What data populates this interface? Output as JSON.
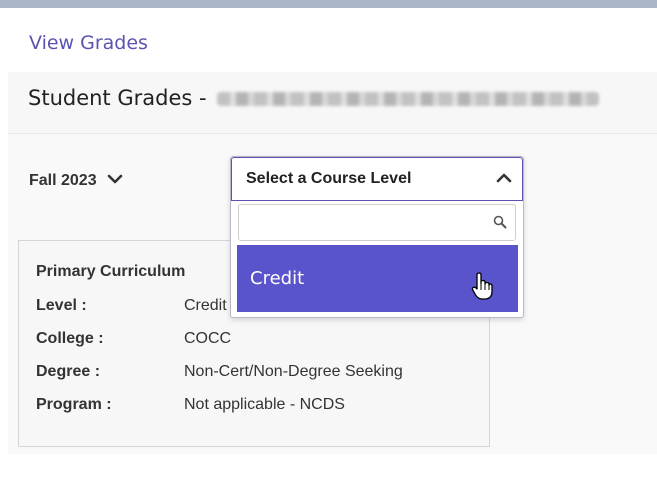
{
  "header": {
    "link": "View Grades",
    "title": "Student Grades - "
  },
  "filters": {
    "term": "Fall 2023",
    "course_level": {
      "label": "Select a Course Level",
      "search_placeholder": "",
      "options": [
        "Credit"
      ]
    }
  },
  "curriculum": {
    "title": "Primary Curriculum",
    "rows": [
      {
        "key": "Level :",
        "value": "Credit"
      },
      {
        "key": "College :",
        "value": "COCC"
      },
      {
        "key": "Degree :",
        "value": "Non-Cert/Non-Degree Seeking"
      },
      {
        "key": "Program :",
        "value": "Not applicable - NCDS"
      }
    ]
  },
  "colors": {
    "accent": "#5a54cc",
    "link": "#5a54b0",
    "top_bar": "#aab5c8"
  },
  "icons": [
    "chevron-down-icon",
    "chevron-up-icon",
    "search-icon",
    "hand-cursor-icon"
  ]
}
